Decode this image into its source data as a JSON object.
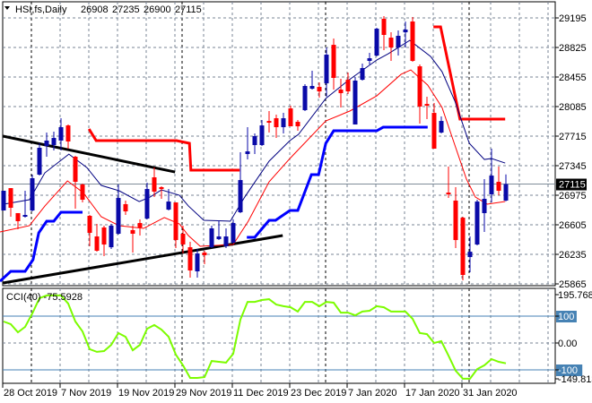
{
  "header": {
    "symbol_label": "HSI,fs,Daily",
    "open": "26908",
    "high": "27235",
    "low": "26900",
    "close": "27115",
    "collapse_icon": "triangle-down-icon"
  },
  "price_axis": {
    "labels": [
      "29195",
      "28825",
      "28455",
      "28085",
      "27715",
      "27345",
      "26975",
      "26605",
      "26235",
      "25865"
    ],
    "current_price": "27115"
  },
  "cci_panel": {
    "title": "CCI(40) -75.5928",
    "max_label": "195.7682",
    "level_high": "100",
    "zero_label": "0.00",
    "level_low": "-100",
    "min_label": "-149.813"
  },
  "time_axis": {
    "labels": [
      {
        "text": "28 Oct 2019",
        "index": 0
      },
      {
        "text": "7 Nov 2019",
        "index": 8
      },
      {
        "text": "19 Nov 2019",
        "index": 16
      },
      {
        "text": "29 Nov 2019",
        "index": 24
      },
      {
        "text": "11 Dec 2019",
        "index": 32
      },
      {
        "text": "23 Dec 2019",
        "index": 40
      },
      {
        "text": "7 Jan 2020",
        "index": 48
      },
      {
        "text": "17 Jan 2020",
        "index": 56
      },
      {
        "text": "31 Jan 2020",
        "index": 64
      }
    ]
  },
  "colors": {
    "bull": "#0a0aa8",
    "bear": "#ff0000",
    "ma_fast": "#000080",
    "ma_slow": "#ff0000",
    "channel_low": "#0000ff",
    "channel_high": "#ff0000",
    "trendline": "#000000",
    "cci": "#7cfc00",
    "cci_levels": "#4682b4",
    "grid": "#7a8596"
  },
  "chart_data": [
    {
      "type": "candlestick",
      "title": "HSI,fs,Daily",
      "ylim": [
        25865,
        29195
      ],
      "ohlc": [
        [
          26784,
          27031,
          26784,
          27031
        ],
        [
          27064,
          27064,
          26706,
          26818
        ],
        [
          26751,
          26751,
          26549,
          26650
        ],
        [
          26706,
          27031,
          26694,
          26728
        ],
        [
          26784,
          27233,
          26773,
          27188
        ],
        [
          27233,
          27625,
          27221,
          27569
        ],
        [
          27591,
          27760,
          27457,
          27659
        ],
        [
          27603,
          27771,
          27535,
          27692
        ],
        [
          27659,
          27939,
          27535,
          27827
        ],
        [
          27849,
          27861,
          27558,
          27648
        ],
        [
          27457,
          27468,
          26807,
          27143
        ],
        [
          27109,
          27121,
          26885,
          26919
        ],
        [
          26717,
          26728,
          26336,
          26504
        ],
        [
          26459,
          26616,
          26268,
          26280
        ],
        [
          26571,
          26594,
          26212,
          26358
        ],
        [
          26324,
          26616,
          26302,
          26594
        ],
        [
          26493,
          27109,
          26481,
          26941
        ],
        [
          26863,
          26908,
          26728,
          26773
        ],
        [
          26538,
          26594,
          26257,
          26493
        ],
        [
          26627,
          26672,
          26470,
          26571
        ],
        [
          26683,
          27132,
          26672,
          27053
        ],
        [
          27199,
          27322,
          26952,
          27020
        ],
        [
          27076,
          27087,
          26930,
          27053
        ],
        [
          26795,
          27053,
          26784,
          26896
        ],
        [
          26885,
          26885,
          26313,
          26414
        ],
        [
          26493,
          26594,
          26246,
          26358
        ],
        [
          26324,
          26392,
          25943,
          26033
        ],
        [
          26022,
          26302,
          25943,
          26246
        ],
        [
          26257,
          26280,
          26112,
          26224
        ],
        [
          26324,
          26594,
          26313,
          26560
        ],
        [
          26425,
          26661,
          26414,
          26459
        ],
        [
          26336,
          26560,
          26313,
          26459
        ],
        [
          26381,
          26672,
          26369,
          26627
        ],
        [
          26762,
          27513,
          26751,
          27165
        ],
        [
          27491,
          27827,
          27423,
          27524
        ],
        [
          27603,
          27748,
          27491,
          27715
        ],
        [
          27603,
          27917,
          27591,
          27849
        ],
        [
          27905,
          28029,
          27760,
          27883
        ],
        [
          27939,
          27984,
          27692,
          27827
        ],
        [
          27827,
          28006,
          27748,
          27939
        ],
        [
          28062,
          28096,
          27838,
          27838
        ],
        [
          27894,
          27917,
          27782,
          27838
        ],
        [
          28040,
          28365,
          28029,
          28343
        ],
        [
          28309,
          28533,
          28298,
          28343
        ],
        [
          28331,
          28388,
          28197,
          28275
        ],
        [
          28376,
          28825,
          28208,
          28735
        ],
        [
          28858,
          28937,
          28298,
          28444
        ],
        [
          28298,
          28432,
          28074,
          28253
        ],
        [
          28421,
          28511,
          28242,
          28275
        ],
        [
          27861,
          28455,
          27861,
          28410
        ],
        [
          28421,
          28623,
          28410,
          28567
        ],
        [
          28657,
          28758,
          28612,
          28690
        ],
        [
          28724,
          29071,
          28713,
          29060
        ],
        [
          29184,
          29217,
          28791,
          28982
        ],
        [
          28948,
          29015,
          28657,
          28825
        ],
        [
          28825,
          29038,
          28724,
          28971
        ],
        [
          29015,
          29150,
          28825,
          29049
        ],
        [
          29150,
          29206,
          28645,
          28657
        ],
        [
          28589,
          28612,
          27872,
          28085
        ],
        [
          28118,
          28208,
          27928,
          28096
        ],
        [
          28006,
          28130,
          27558,
          27558
        ],
        [
          27760,
          27961,
          27748,
          27905
        ],
        [
          27008,
          27334,
          26941,
          26986
        ],
        [
          26908,
          27076,
          26313,
          26414
        ],
        [
          26694,
          26706,
          25910,
          25977
        ],
        [
          26201,
          26459,
          26011,
          26268
        ],
        [
          26358,
          26919,
          26347,
          26896
        ],
        [
          26751,
          27177,
          26515,
          26930
        ],
        [
          26986,
          27558,
          26885,
          27221
        ],
        [
          27143,
          27334,
          26975,
          27031
        ],
        [
          26908,
          27235,
          26900,
          27115
        ]
      ],
      "ma_fast": [
        [
          0,
          26863
        ],
        [
          3.6,
          26919
        ],
        [
          5.75,
          27255
        ],
        [
          9.1,
          27490
        ],
        [
          11.6,
          27322
        ],
        [
          13.6,
          27098
        ],
        [
          16.1,
          27031
        ],
        [
          18.9,
          26896
        ],
        [
          20.4,
          26952
        ],
        [
          22,
          27042
        ],
        [
          24.5,
          26975
        ],
        [
          25.75,
          26841
        ],
        [
          27.9,
          26661
        ],
        [
          31.6,
          26650
        ],
        [
          33.6,
          26952
        ],
        [
          37,
          27401
        ],
        [
          39.9,
          27659
        ],
        [
          41.1,
          27737
        ],
        [
          44.9,
          28186
        ],
        [
          48,
          28410
        ],
        [
          52,
          28668
        ],
        [
          53.6,
          28746
        ],
        [
          56.6,
          28914
        ],
        [
          59.5,
          28713
        ],
        [
          61.1,
          28522
        ],
        [
          62.9,
          28152
        ],
        [
          64.9,
          27625
        ],
        [
          67,
          27423
        ],
        [
          68,
          27435
        ],
        [
          69.9,
          27378
        ]
      ],
      "ma_slow": [
        [
          -0.5,
          26515
        ],
        [
          3.6,
          26594
        ],
        [
          5.75,
          26840
        ],
        [
          8.9,
          27154
        ],
        [
          11.1,
          27008
        ],
        [
          13.6,
          26706
        ],
        [
          16.1,
          26594
        ],
        [
          19.5,
          26560
        ],
        [
          22.4,
          26695
        ],
        [
          24.5,
          26616
        ],
        [
          25.75,
          26470
        ],
        [
          27.4,
          26336
        ],
        [
          32,
          26358
        ],
        [
          34.1,
          26650
        ],
        [
          37,
          27143
        ],
        [
          39.9,
          27435
        ],
        [
          44.9,
          27905
        ],
        [
          48.25,
          28029
        ],
        [
          52,
          28219
        ],
        [
          55.4,
          28489
        ],
        [
          56.75,
          28544
        ],
        [
          59.1,
          28354
        ],
        [
          61.1,
          28074
        ],
        [
          64.5,
          27177
        ],
        [
          65.75,
          26952
        ],
        [
          67.4,
          26863
        ],
        [
          69.9,
          26896
        ]
      ],
      "channel_low": [
        [
          [
            -0.5,
            25898
          ],
          [
            1,
            26022
          ],
          [
            3,
            26022
          ],
          [
            4.1,
            26168
          ],
          [
            4.9,
            26504
          ],
          [
            6,
            26650
          ],
          [
            7,
            26650
          ],
          [
            8,
            26762
          ],
          [
            11,
            26762
          ]
        ],
        [
          [
            33.9,
            26448
          ],
          [
            35,
            26448
          ],
          [
            37,
            26661
          ],
          [
            37.9,
            26661
          ],
          [
            39.9,
            26784
          ],
          [
            41,
            26784
          ],
          [
            42.9,
            27233
          ],
          [
            43.9,
            27233
          ],
          [
            44.9,
            27625
          ],
          [
            46,
            27782
          ],
          [
            52,
            27782
          ],
          [
            52.9,
            27827
          ],
          [
            59.1,
            27827
          ]
        ]
      ],
      "channel_high": [
        [
          [
            11.9,
            27805
          ],
          [
            12.9,
            27659
          ],
          [
            24.1,
            27659
          ],
          [
            25.9,
            27625
          ],
          [
            26.1,
            27289
          ],
          [
            32.9,
            27289
          ]
        ],
        [
          [
            59.9,
            29083
          ],
          [
            60.9,
            29083
          ],
          [
            63.6,
            27928
          ],
          [
            69.9,
            27928
          ]
        ]
      ],
      "trendlines": [
        [
          [
            -0.1,
            27715
          ],
          [
            23.9,
            27266
          ]
        ],
        [
          [
            -0.1,
            25876
          ],
          [
            38.9,
            26470
          ]
        ]
      ]
    },
    {
      "type": "line",
      "title": "CCI(40)",
      "ylim": [
        -149.813,
        195.7682
      ],
      "levels": [
        100,
        0,
        -100
      ],
      "values": [
        80,
        70,
        40,
        60,
        110,
        167,
        177,
        177,
        177,
        147,
        80,
        43,
        -23,
        -33,
        -30,
        -7,
        37,
        23,
        -27,
        -7,
        53,
        67,
        50,
        23,
        -43,
        -83,
        -130,
        -130,
        -127,
        -67,
        -70,
        -73,
        -40,
        87,
        153,
        153,
        160,
        163,
        143,
        137,
        133,
        117,
        153,
        153,
        137,
        153,
        150,
        113,
        113,
        103,
        117,
        120,
        137,
        133,
        117,
        117,
        117,
        90,
        37,
        33,
        0,
        7,
        -47,
        -103,
        -133,
        -133,
        -97,
        -83,
        -60,
        -70,
        -75.5928
      ]
    }
  ]
}
